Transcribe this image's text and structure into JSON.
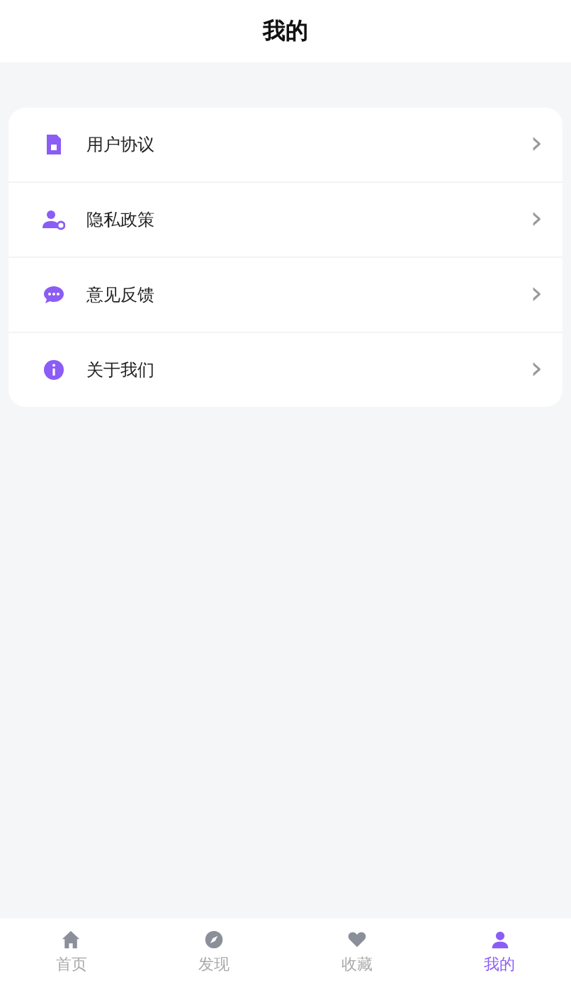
{
  "header": {
    "title": "我的"
  },
  "menu": [
    {
      "kind": "document",
      "label": "用户协议",
      "chevron": "›"
    },
    {
      "kind": "privacy",
      "label": "隐私政策",
      "chevron": "›"
    },
    {
      "kind": "chat",
      "label": "意见反馈",
      "chevron": "›"
    },
    {
      "kind": "info",
      "label": "关于我们",
      "chevron": "›"
    }
  ],
  "tabs": [
    {
      "kind": "home",
      "label": "首页",
      "selected": false
    },
    {
      "kind": "compass",
      "label": "发现",
      "selected": false
    },
    {
      "kind": "heart",
      "label": "收藏",
      "selected": false
    },
    {
      "kind": "person",
      "label": "我的",
      "selected": true
    }
  ]
}
